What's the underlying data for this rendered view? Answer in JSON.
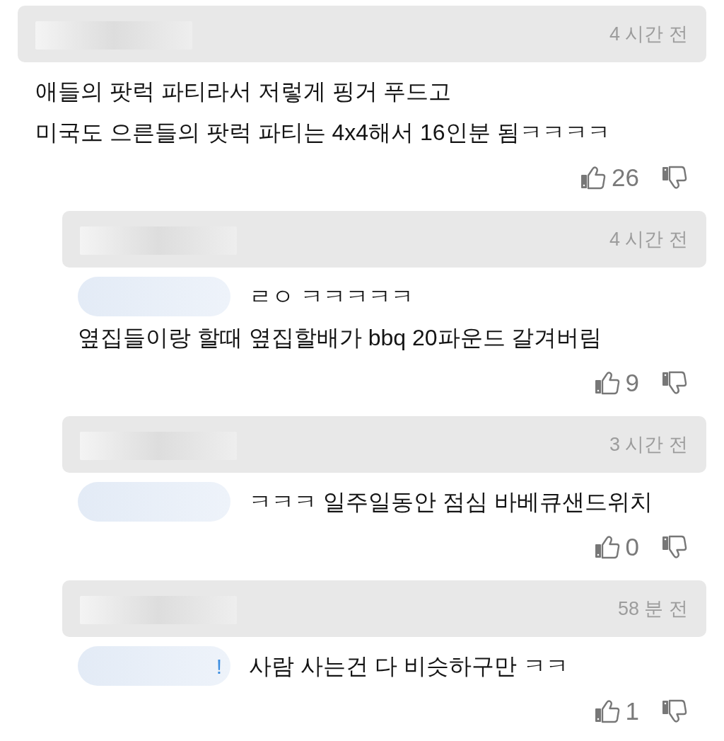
{
  "comments": [
    {
      "kind": "comment",
      "time": "4 시간 전",
      "lines": [
        "애들의 팟럭 파티라서 저렇게 핑거 푸드고",
        "미국도 으른들의 팟럭 파티는 4x4해서 16인분 됨ㅋㅋㅋㅋ"
      ],
      "likes": "26"
    },
    {
      "kind": "reply",
      "time": "4 시간 전",
      "mention": true,
      "lines": [
        "ㄹㅇ ㅋㅋㅋㅋㅋ",
        "옆집들이랑 할때 옆집할배가 bbq 20파운드 갈겨버림"
      ],
      "likes": "9"
    },
    {
      "kind": "reply",
      "time": "3 시간 전",
      "mention": true,
      "lines": [
        "ㅋㅋㅋ 일주일동안 점심 바베큐샌드위치"
      ],
      "likes": "0"
    },
    {
      "kind": "reply",
      "time": "58 분 전",
      "mention": true,
      "mention_text": "!",
      "lines": [
        "사람 사는건 다 비슷하구만 ㅋㅋ"
      ],
      "likes": "1"
    }
  ]
}
